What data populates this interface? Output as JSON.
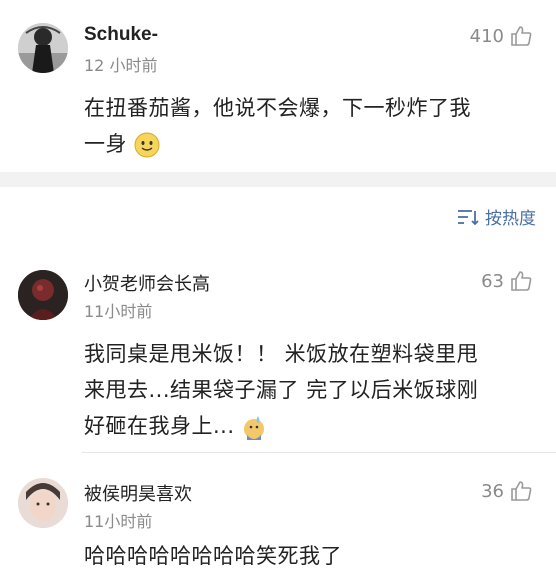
{
  "comments_top": {
    "username": "Schuke-",
    "time": "12 小时前",
    "likes": "410",
    "text_line1": "在扭番茄酱，他说不会爆，下一秒炸了我",
    "text_line2": "一身"
  },
  "sort": {
    "label": "按热度"
  },
  "comments": [
    {
      "username": "小贺老师会长高",
      "time": "11小时前",
      "likes": "63",
      "line1": "我同桌是甩米饭！！ 米饭放在塑料袋里甩",
      "line2": "来甩去...结果袋子漏了 完了以后米饭球刚",
      "line3": "好砸在我身上..."
    },
    {
      "username": "被侯明昊喜欢",
      "time": "11小时前",
      "likes": "36",
      "line1": "哈哈哈哈哈哈哈哈笑死我了"
    }
  ],
  "colors": {
    "accent": "#4a6fa5",
    "muted": "#8a8a8a",
    "divider": "#f2f2f2"
  }
}
